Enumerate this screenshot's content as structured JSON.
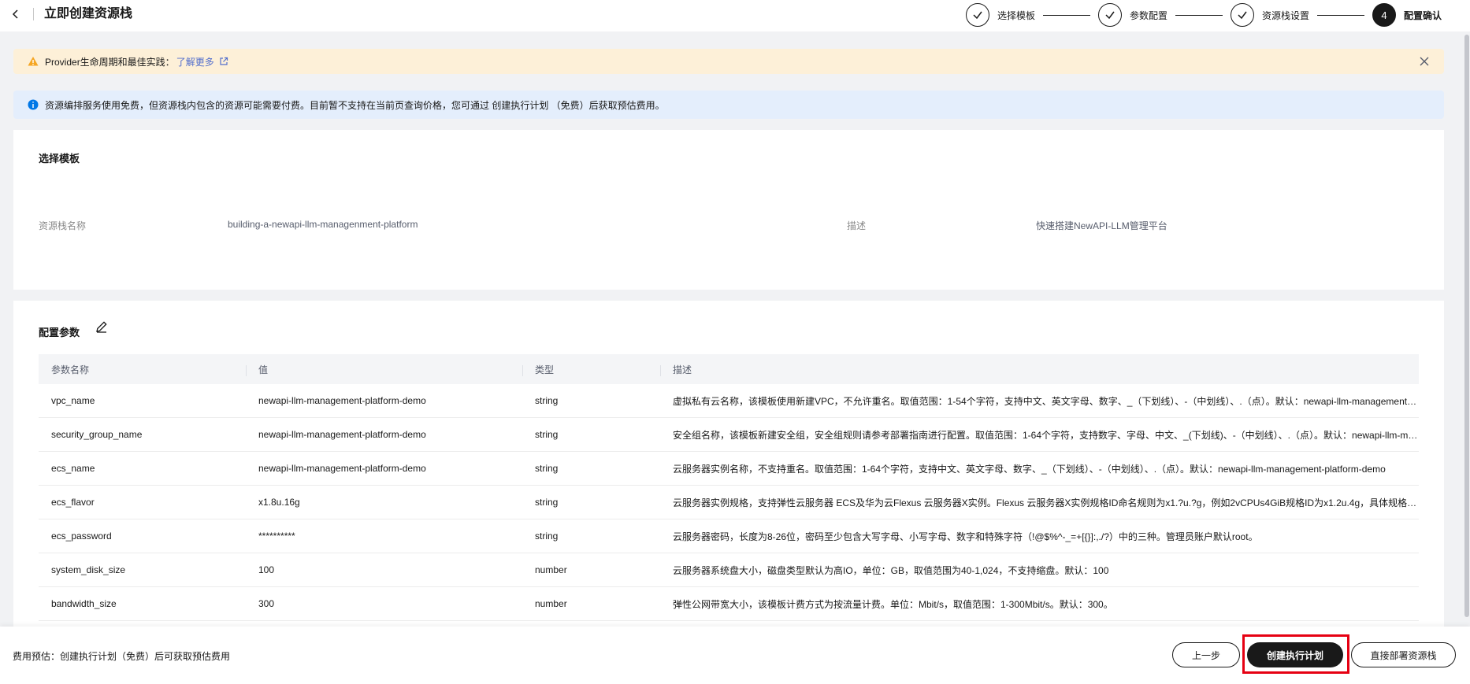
{
  "header": {
    "title": "立即创建资源栈",
    "steps": [
      {
        "label": "选择模板",
        "state": "done"
      },
      {
        "label": "参数配置",
        "state": "done"
      },
      {
        "label": "资源栈设置",
        "state": "done"
      },
      {
        "label": "配置确认",
        "state": "active",
        "number": "4"
      }
    ]
  },
  "banners": {
    "warning": {
      "text": "Provider生命周期和最佳实践：",
      "link": "了解更多",
      "icon": "warning-icon"
    },
    "info": {
      "text": "资源编排服务使用免费，但资源栈内包含的资源可能需要付费。目前暂不支持在当前页查询价格，您可通过 创建执行计划 （免费）后获取预估费用。",
      "icon": "info-icon"
    }
  },
  "template": {
    "title": "选择模板",
    "stack_name_label": "资源栈名称",
    "stack_name_value": "building-a-newapi-llm-managenment-platform",
    "desc_label": "描述",
    "desc_value": "快速搭建NewAPI-LLM管理平台"
  },
  "params": {
    "title": "配置参数",
    "columns": [
      "参数名称",
      "值",
      "类型",
      "描述"
    ],
    "rows": [
      {
        "name": "vpc_name",
        "value": "newapi-llm-management-platform-demo",
        "type": "string",
        "desc": "虚拟私有云名称，该模板使用新建VPC，不允许重名。取值范围：1-54个字符，支持中文、英文字母、数字、_（下划线）、-（中划线）、.（点）。默认：newapi-llm-management-platform-demo"
      },
      {
        "name": "security_group_name",
        "value": "newapi-llm-management-platform-demo",
        "type": "string",
        "desc": "安全组名称，该模板新建安全组，安全组规则请参考部署指南进行配置。取值范围：1-64个字符，支持数字、字母、中文、_(下划线)、-（中划线）、.（点）。默认：newapi-llm-management-platform-demo"
      },
      {
        "name": "ecs_name",
        "value": "newapi-llm-management-platform-demo",
        "type": "string",
        "desc": "云服务器实例名称，不支持重名。取值范围：1-64个字符，支持中文、英文字母、数字、_（下划线）、-（中划线）、.（点）。默认：newapi-llm-management-platform-demo"
      },
      {
        "name": "ecs_flavor",
        "value": "x1.8u.16g",
        "type": "string",
        "desc": "云服务器实例规格，支持弹性云服务器 ECS及华为云Flexus 云服务器X实例。Flexus 云服务器X实例规格ID命名规则为x1.?u.?g，例如2vCPUs4GiB规格ID为x1.2u.4g，具体规格请参考官网"
      },
      {
        "name": "ecs_password",
        "value": "**********",
        "type": "string",
        "desc": "云服务器密码，长度为8-26位，密码至少包含大写字母、小写字母、数字和特殊字符（!@$%^-_=+[{}]:,./?）中的三种。管理员账户默认root。"
      },
      {
        "name": "system_disk_size",
        "value": "100",
        "type": "number",
        "desc": "云服务器系统盘大小，磁盘类型默认为高IO，单位：GB，取值范围为40-1,024，不支持缩盘。默认：100"
      },
      {
        "name": "bandwidth_size",
        "value": "300",
        "type": "number",
        "desc": "弹性公网带宽大小，该模板计费方式为按流量计费。单位：Mbit/s，取值范围：1-300Mbit/s。默认：300。"
      }
    ]
  },
  "footer": {
    "cost_note": "费用预估：创建执行计划（免费）后可获取预估费用",
    "prev_label": "上一步",
    "plan_label": "创建执行计划",
    "deploy_label": "直接部署资源栈"
  },
  "colors": {
    "dark": "#191919",
    "link": "#526ecc",
    "warning_bg": "#fdf0d8",
    "info_bg": "#e4eefc",
    "highlight": "#e60012"
  }
}
